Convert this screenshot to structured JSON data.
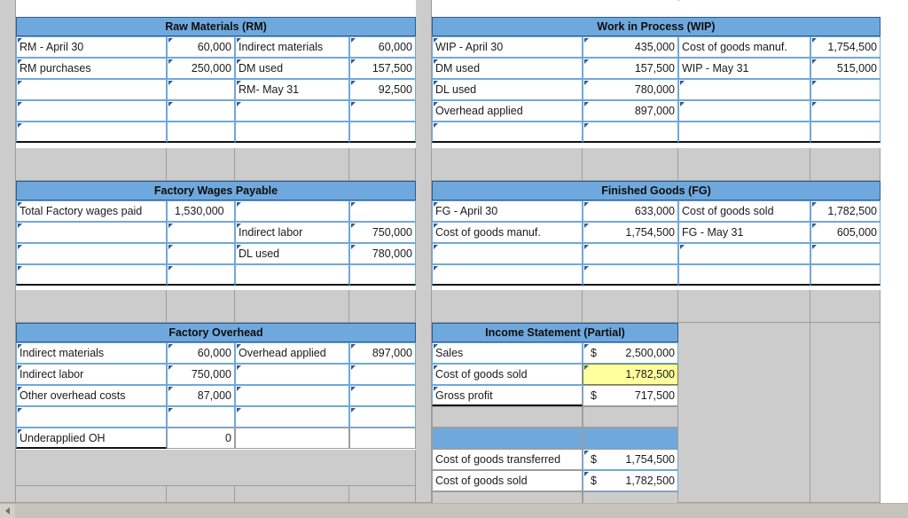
{
  "app": {
    "type": "spreadsheet",
    "colors": {
      "header_blue": "#6fa8dc",
      "grid_gray": "#cccccc",
      "highlight_yellow": "#ffff9e",
      "cell_border_blue": "#6fa8dc",
      "scrollbar": "#d4d0c8"
    }
  },
  "blocks": {
    "raw_materials": {
      "title": "Raw Materials (RM)",
      "rows": [
        {
          "debit_label": "RM - April 30",
          "debit_value": "60,000",
          "credit_label": "Indirect materials",
          "credit_value": "60,000"
        },
        {
          "debit_label": "RM purchases",
          "debit_value": "250,000",
          "credit_label": "DM used",
          "credit_value": "157,500"
        },
        {
          "debit_label": "",
          "debit_value": "",
          "credit_label": "RM- May 31",
          "credit_value": "92,500"
        },
        {
          "debit_label": "",
          "debit_value": "",
          "credit_label": "",
          "credit_value": ""
        },
        {
          "debit_label": "",
          "debit_value": "",
          "credit_label": "",
          "credit_value": ""
        }
      ]
    },
    "work_in_process": {
      "title": "Work in Process (WIP)",
      "rows": [
        {
          "debit_label": "WIP - April 30",
          "debit_value": "435,000",
          "credit_label": "Cost of goods manuf.",
          "credit_value": "1,754,500"
        },
        {
          "debit_label": "DM used",
          "debit_value": "157,500",
          "credit_label": "WIP - May 31",
          "credit_value": "515,000"
        },
        {
          "debit_label": "DL used",
          "debit_value": "780,000",
          "credit_label": "",
          "credit_value": ""
        },
        {
          "debit_label": "Overhead applied",
          "debit_value": "897,000",
          "credit_label": "",
          "credit_value": ""
        },
        {
          "debit_label": "",
          "debit_value": "",
          "credit_label": "",
          "credit_value": ""
        }
      ]
    },
    "factory_wages_payable": {
      "title": "Factory Wages Payable",
      "rows": [
        {
          "debit_label": "Total Factory wages paid",
          "debit_value": "1,530,000",
          "credit_label": "",
          "credit_value": ""
        },
        {
          "debit_label": "",
          "debit_value": "",
          "credit_label": "Indirect labor",
          "credit_value": "750,000"
        },
        {
          "debit_label": "",
          "debit_value": "",
          "credit_label": "DL used",
          "credit_value": "780,000"
        },
        {
          "debit_label": "",
          "debit_value": "",
          "credit_label": "",
          "credit_value": ""
        }
      ]
    },
    "finished_goods": {
      "title": "Finished Goods (FG)",
      "rows": [
        {
          "debit_label": "FG - April 30",
          "debit_value": "633,000",
          "credit_label": "Cost of goods sold",
          "credit_value": "1,782,500"
        },
        {
          "debit_label": "Cost of goods manuf.",
          "debit_value": "1,754,500",
          "credit_label": "FG - May 31",
          "credit_value": "605,000"
        },
        {
          "debit_label": "",
          "debit_value": "",
          "credit_label": "",
          "credit_value": ""
        },
        {
          "debit_label": "",
          "debit_value": "",
          "credit_label": "",
          "credit_value": ""
        }
      ]
    },
    "factory_overhead": {
      "title": "Factory Overhead",
      "rows": [
        {
          "debit_label": "Indirect materials",
          "debit_value": "60,000",
          "credit_label": "Overhead applied",
          "credit_value": "897,000"
        },
        {
          "debit_label": "Indirect labor",
          "debit_value": "750,000",
          "credit_label": "",
          "credit_value": ""
        },
        {
          "debit_label": "Other overhead costs",
          "debit_value": "87,000",
          "credit_label": "",
          "credit_value": ""
        },
        {
          "debit_label": "",
          "debit_value": "",
          "credit_label": "",
          "credit_value": ""
        }
      ],
      "total_row": {
        "debit_label": "Underapplied OH",
        "debit_value": "0",
        "credit_label": "",
        "credit_value": ""
      }
    },
    "income_statement": {
      "title": "Income Statement (Partial)",
      "rows": [
        {
          "label": "Sales",
          "currency": "$",
          "value": "2,500,000",
          "highlight": false
        },
        {
          "label": "Cost of goods sold",
          "currency": "",
          "value": "1,782,500",
          "highlight": true
        },
        {
          "label": "Gross profit",
          "currency": "$",
          "value": "717,500",
          "highlight": false
        }
      ]
    },
    "summary": {
      "rows": [
        {
          "label": "Cost of goods transferred",
          "currency": "$",
          "value": "1,754,500"
        },
        {
          "label": "Cost of goods sold",
          "currency": "$",
          "value": "1,782,500"
        }
      ]
    }
  },
  "scrollbar": {
    "left_arrow": "◀"
  }
}
